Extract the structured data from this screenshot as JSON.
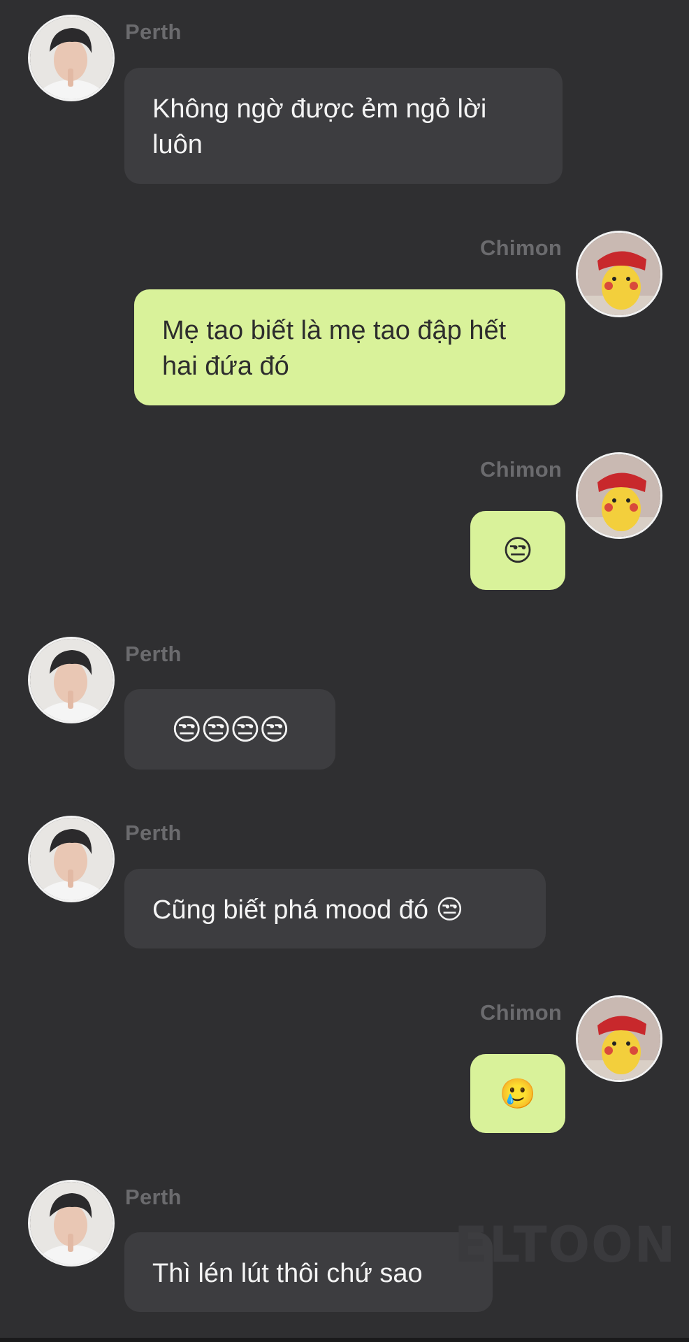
{
  "users": {
    "perth": {
      "name": "Perth"
    },
    "chimon": {
      "name": "Chimon"
    }
  },
  "messages": [
    {
      "sender": "Perth",
      "text": "Không ngờ được ẻm ngỏ lời luôn"
    },
    {
      "sender": "Chimon",
      "text": "Mẹ tao biết là mẹ tao đập hết hai đứa đó"
    },
    {
      "sender": "Chimon",
      "text": "😒"
    },
    {
      "sender": "Perth",
      "text": "😒😒😒😒"
    },
    {
      "sender": "Perth",
      "text": "Cũng biết phá mood đó 😒"
    },
    {
      "sender": "Chimon",
      "text": "🥲"
    },
    {
      "sender": "Perth",
      "text": "Thì lén lút thôi chứ sao"
    }
  ],
  "watermark": "ELTOON",
  "colors": {
    "background": "#2f2f31",
    "incoming_bubble": "#3d3d40",
    "outgoing_bubble": "#d9f29a",
    "name_text": "#6b6b6e"
  }
}
